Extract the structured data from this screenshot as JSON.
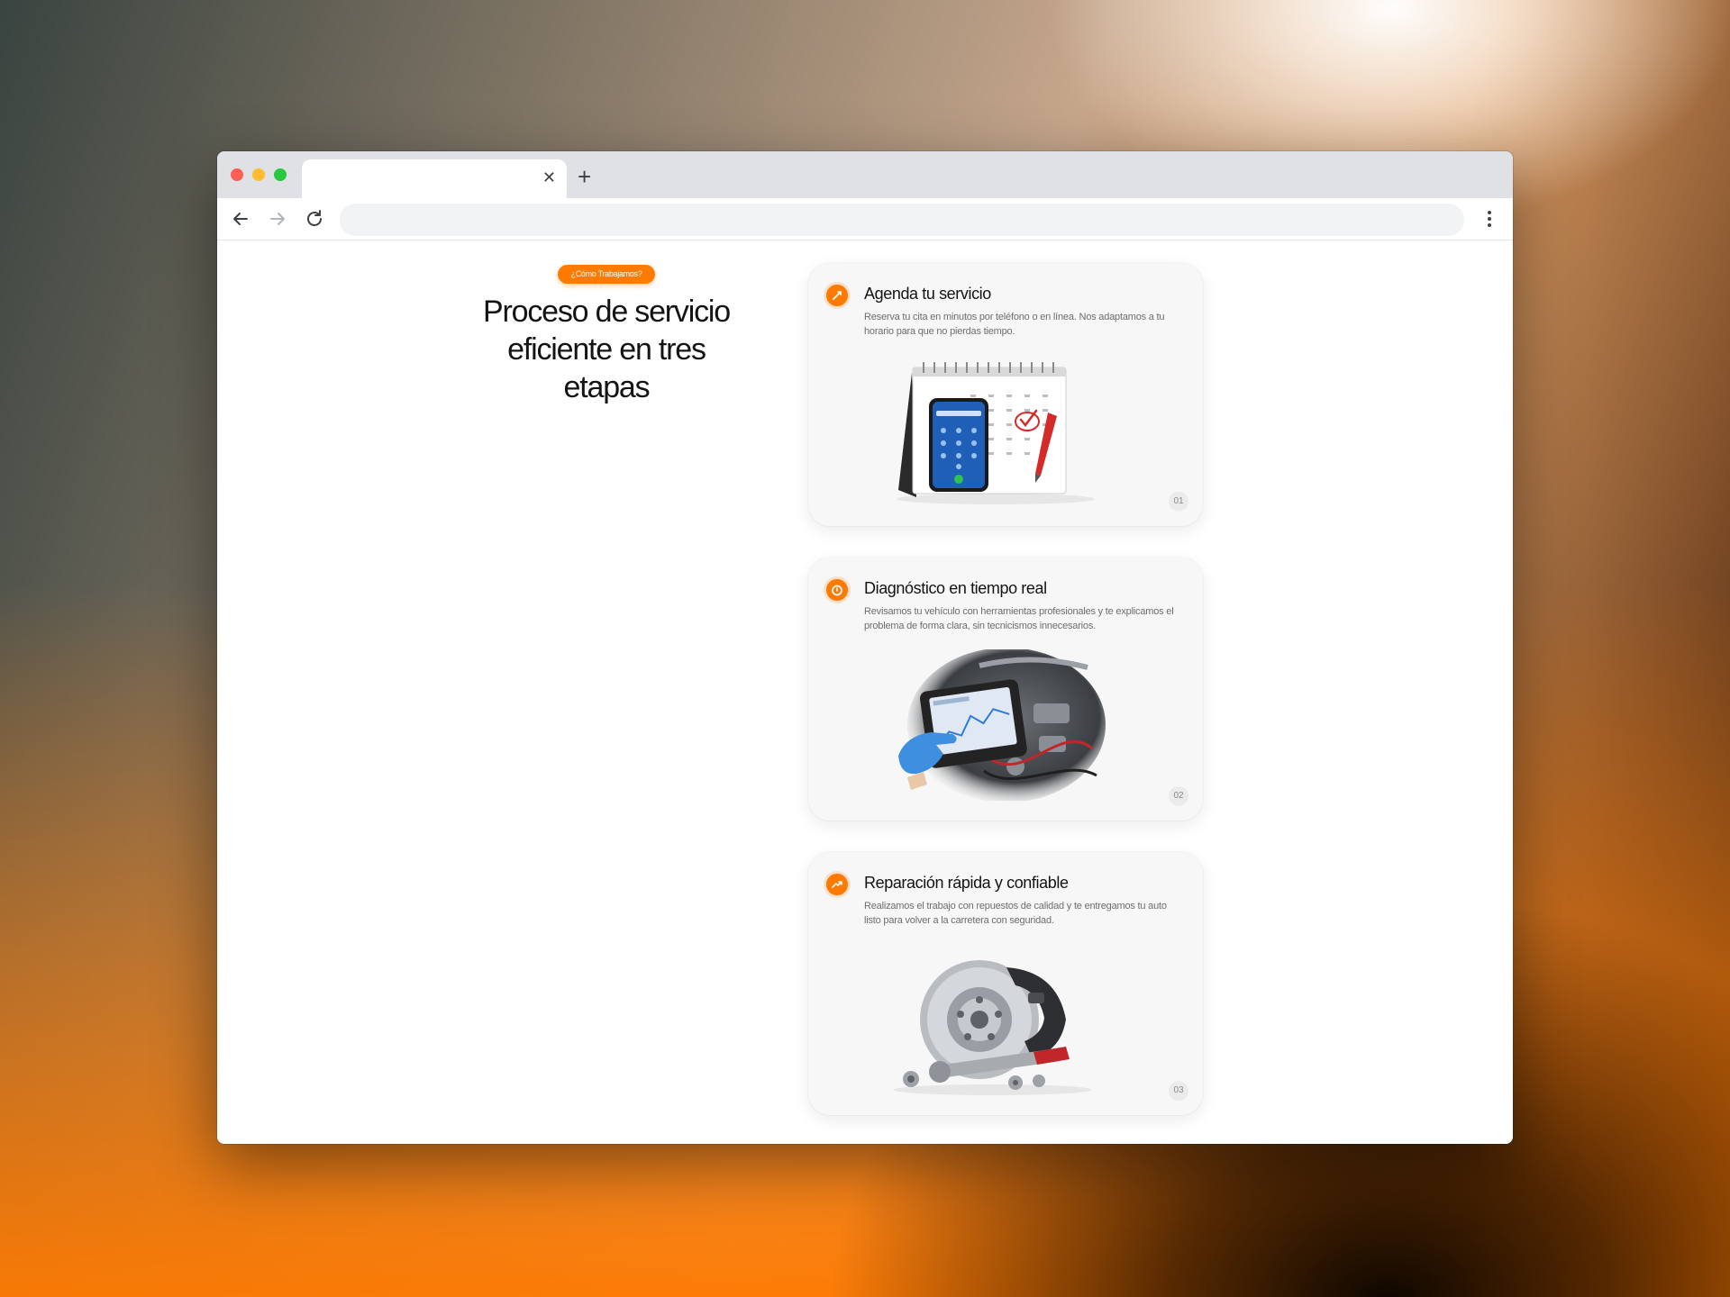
{
  "browser": {
    "tab_title": "",
    "tab_close": "✕",
    "new_tab": "+",
    "url": ""
  },
  "section": {
    "badge": "¿Cómo Trabajamos?",
    "title": "Proceso de servicio eficiente en tres etapas"
  },
  "steps": [
    {
      "title": "Agenda tu servicio",
      "description": "Reserva tu cita en minutos por teléfono o en línea. Nos adaptamos a tu horario para que no pierdas tiempo.",
      "number": "01",
      "icon": "calendar-icon",
      "image": "phone-and-calendar-illustration"
    },
    {
      "title": "Diagnóstico en tiempo real",
      "description": "Revisamos tu vehículo con herramientas profesionales y te explicamos el problema de forma clara, sin tecnicismos innecesarios.",
      "number": "02",
      "icon": "clock-icon",
      "image": "diagnostic-tablet-engine-illustration"
    },
    {
      "title": "Reparación rápida y confiable",
      "description": "Realizamos el trabajo con repuestos de calidad y te entregamos tu auto listo para volver a la carretera con seguridad.",
      "number": "03",
      "icon": "trend-up-icon",
      "image": "brake-disc-and-tools-illustration"
    }
  ],
  "colors": {
    "accent": "#ff7a00",
    "card_background": "#f7f7f7",
    "heading": "#141414",
    "body_text": "#6d6d6d"
  }
}
